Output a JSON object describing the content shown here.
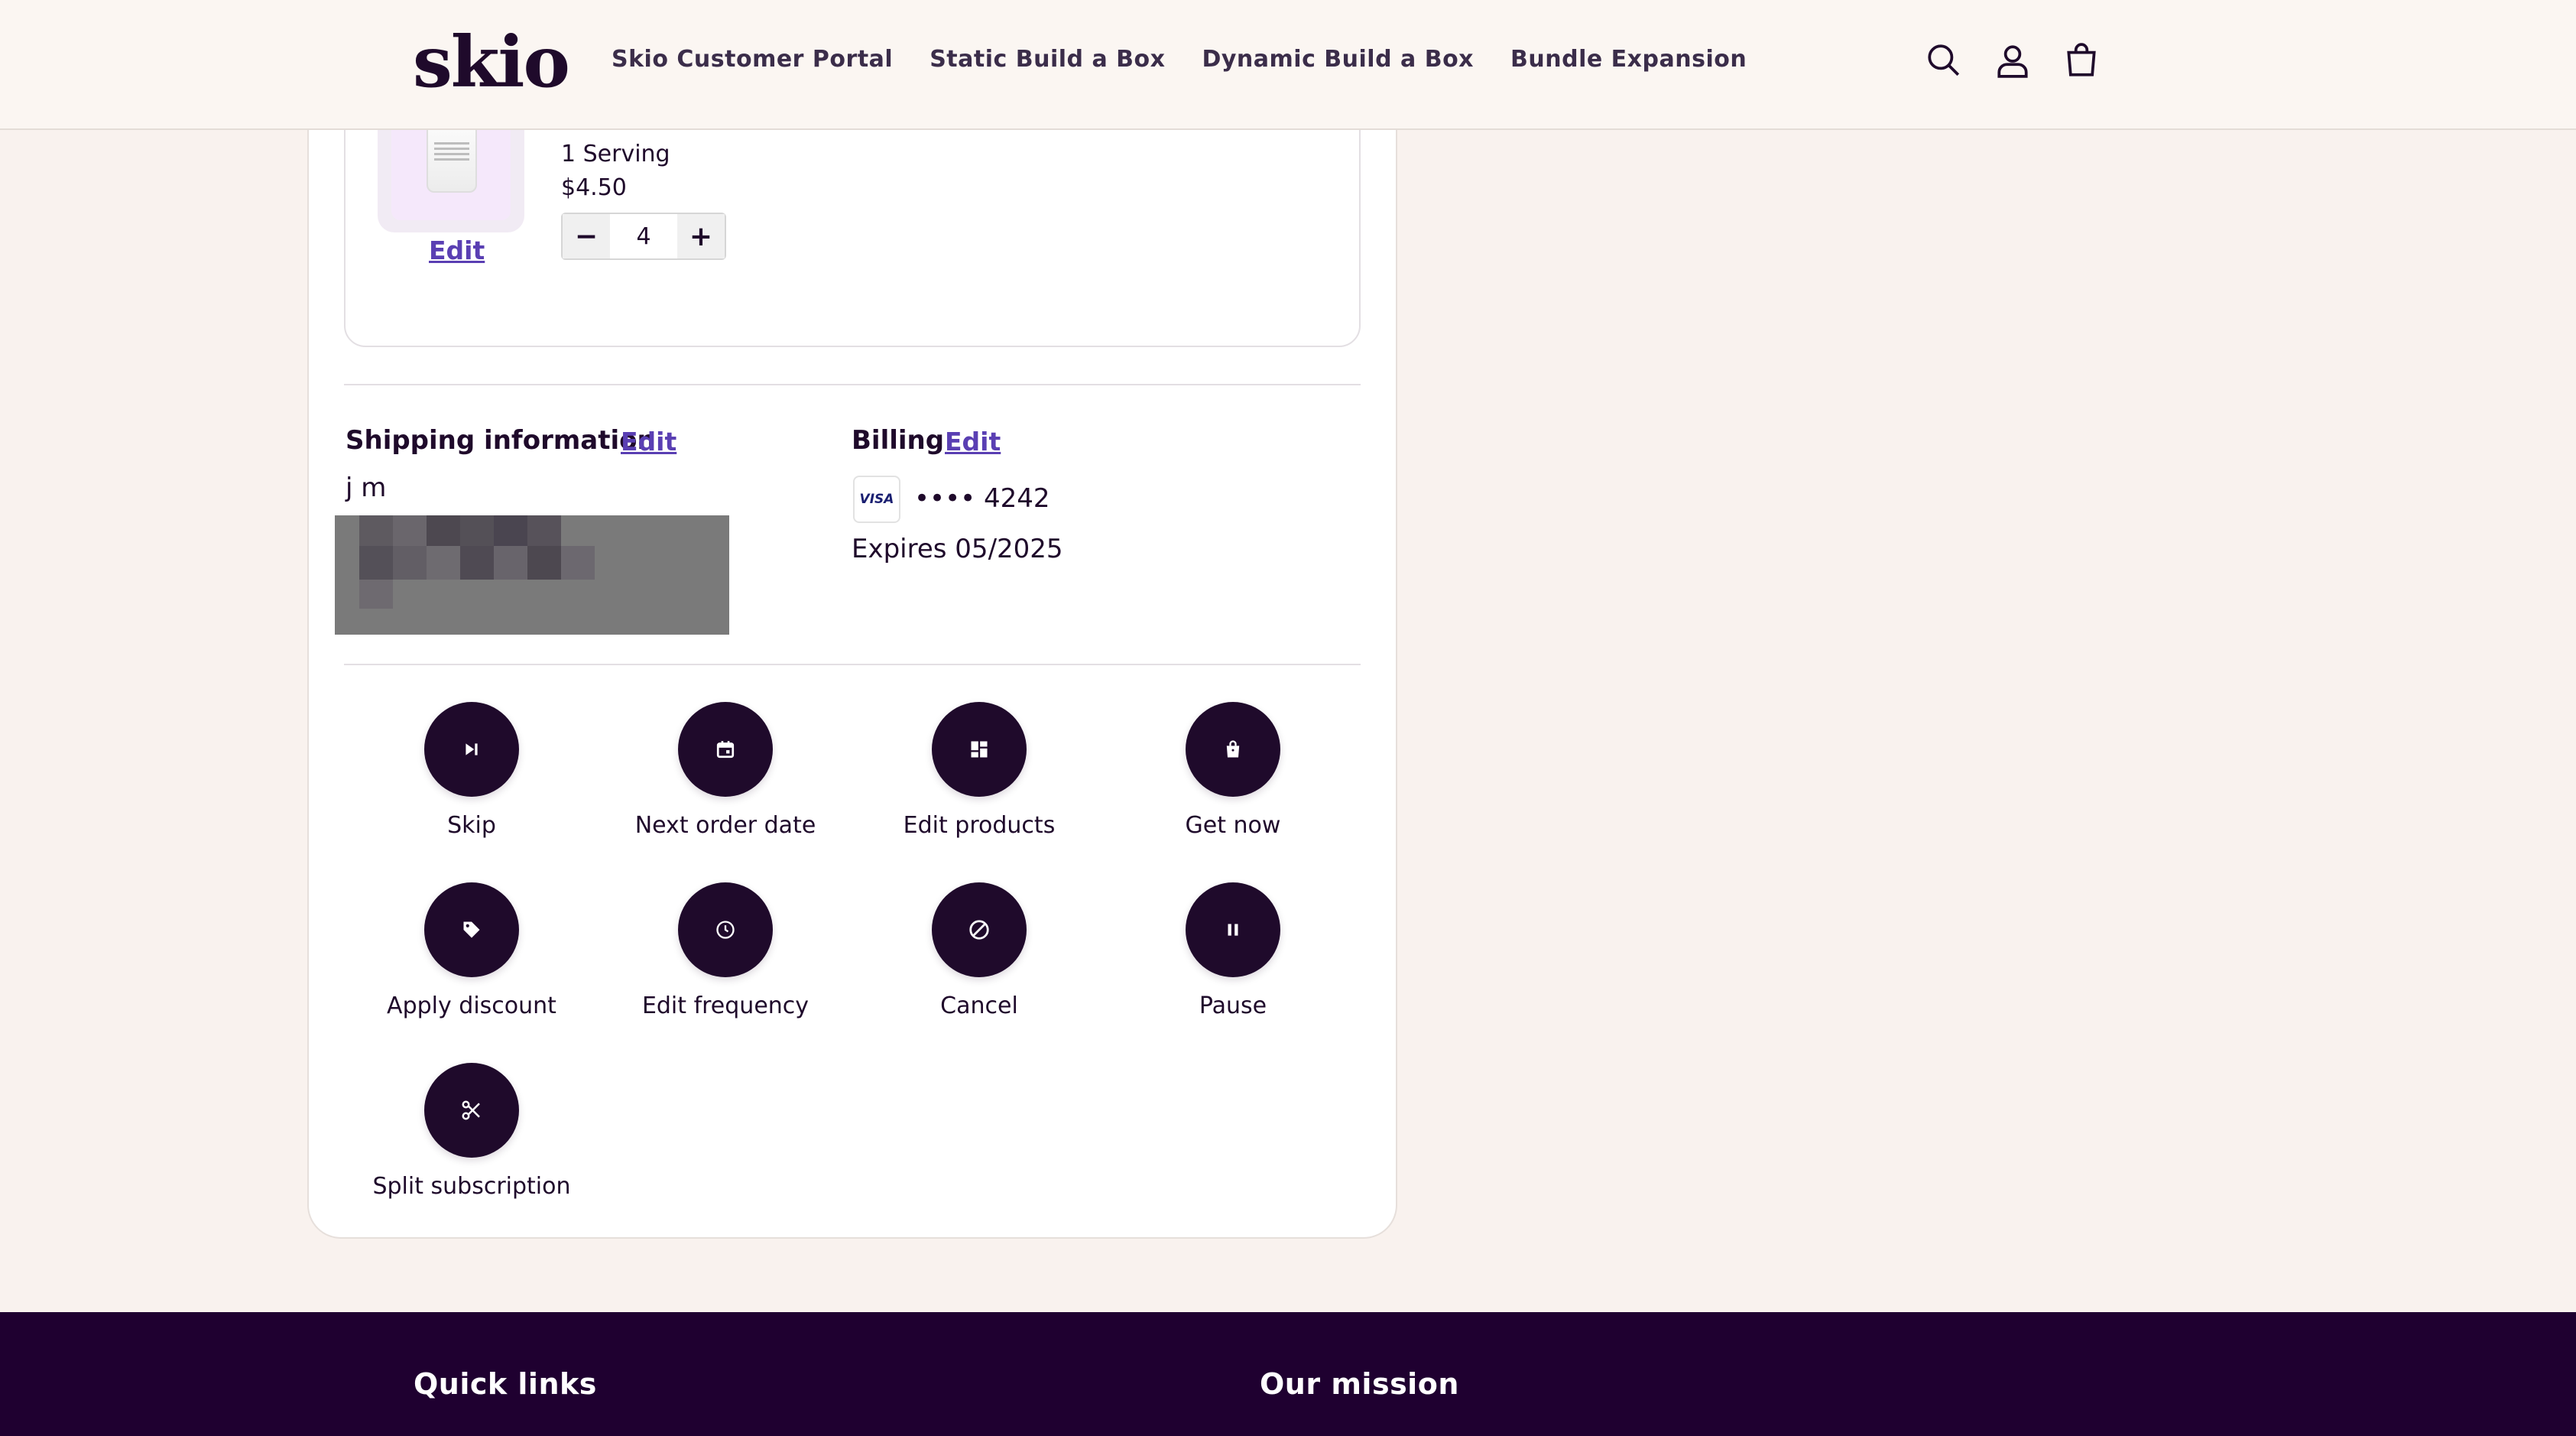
{
  "header": {
    "logo": "skio",
    "nav": [
      "Skio Customer Portal",
      "Static Build a Box",
      "Dynamic Build a Box",
      "Bundle Expansion"
    ]
  },
  "product": {
    "edit_label": "Edit",
    "variant": "1 Serving",
    "price": "$4.50",
    "quantity": "4",
    "decrement": "−",
    "increment": "+"
  },
  "shipping": {
    "title": "Shipping information",
    "edit_label": "Edit",
    "name": "j m"
  },
  "billing": {
    "title": "Billing",
    "edit_label": "Edit",
    "card_brand": "VISA",
    "card_last4": "•••• 4242",
    "expires": "Expires 05/2025"
  },
  "actions": [
    {
      "label": "Skip",
      "icon": "skip-icon"
    },
    {
      "label": "Next order date",
      "icon": "calendar-icon"
    },
    {
      "label": "Edit products",
      "icon": "grid-icon"
    },
    {
      "label": "Get now",
      "icon": "shopping-bag-icon"
    },
    {
      "label": "Apply discount",
      "icon": "tag-icon"
    },
    {
      "label": "Edit frequency",
      "icon": "clock-icon"
    },
    {
      "label": "Cancel",
      "icon": "cancel-icon"
    },
    {
      "label": "Pause",
      "icon": "pause-icon"
    },
    {
      "label": "Split subscription",
      "icon": "scissors-icon"
    }
  ],
  "footer": {
    "quick_links": "Quick links",
    "our_mission": "Our mission"
  },
  "colors": {
    "primary": "#1f0a2b",
    "link": "#5a3fb3",
    "background": "#f9f2ee",
    "footer": "#1f0030"
  }
}
